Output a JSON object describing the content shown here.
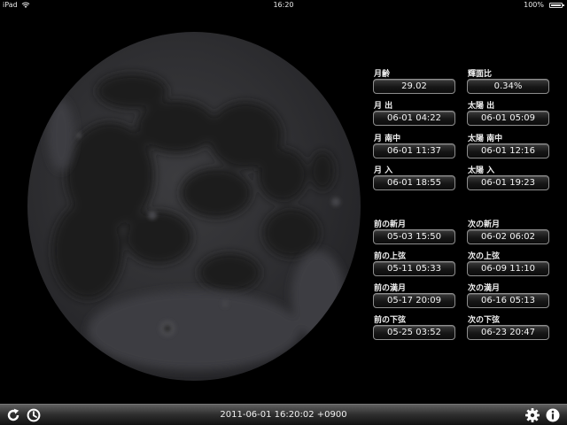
{
  "status_bar": {
    "carrier": "iPad",
    "time": "16:20",
    "battery": "100%",
    "icons": [
      "wifi-icon",
      "battery-icon"
    ]
  },
  "moon": {
    "icon": "moon-image"
  },
  "info": {
    "moon_age": {
      "label": "月齢",
      "value": "29.02"
    },
    "illumination": {
      "label": "輝面比",
      "value": "0.34%"
    },
    "moonrise": {
      "label": "月 出",
      "value": "06-01 04:22"
    },
    "sunrise": {
      "label": "太陽 出",
      "value": "06-01 05:09"
    },
    "moon_transit": {
      "label": "月 南中",
      "value": "06-01 11:37"
    },
    "sun_transit": {
      "label": "太陽 南中",
      "value": "06-01 12:16"
    },
    "moonset": {
      "label": "月 入",
      "value": "06-01 18:55"
    },
    "sunset": {
      "label": "太陽 入",
      "value": "06-01 19:23"
    },
    "prev_new_moon": {
      "label": "前の新月",
      "value": "05-03 15:50"
    },
    "next_new_moon": {
      "label": "次の新月",
      "value": "06-02 06:02"
    },
    "prev_first_quarter": {
      "label": "前の上弦",
      "value": "05-11 05:33"
    },
    "next_first_quarter": {
      "label": "次の上弦",
      "value": "06-09 11:10"
    },
    "prev_full_moon": {
      "label": "前の満月",
      "value": "05-17 20:09"
    },
    "next_full_moon": {
      "label": "次の満月",
      "value": "06-16 05:13"
    },
    "prev_last_quarter": {
      "label": "前の下弦",
      "value": "05-25 03:52"
    },
    "next_last_quarter": {
      "label": "次の下弦",
      "value": "06-23 20:47"
    }
  },
  "toolbar": {
    "datetime": "2011-06-01 16:20:02 +0900",
    "icons": [
      "refresh-icon",
      "clock-icon",
      "gear-icon",
      "info-icon"
    ],
    "accent": "#ffffff"
  }
}
